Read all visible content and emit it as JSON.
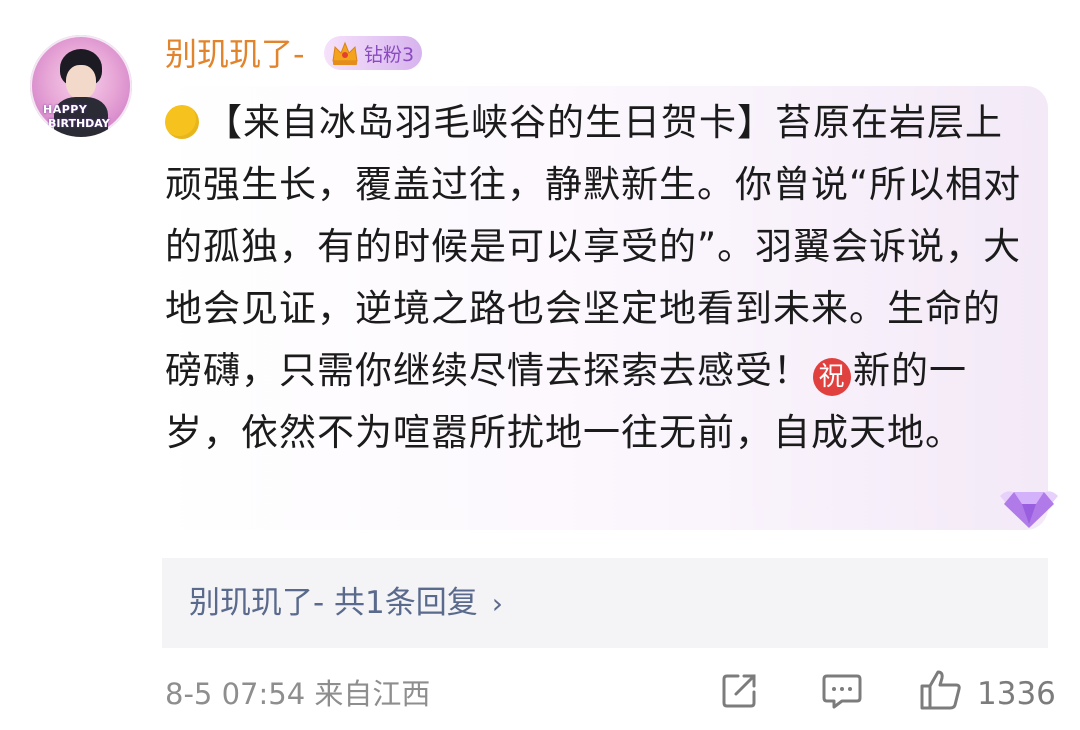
{
  "comment": {
    "username": "别玑玑了-",
    "fan_badge": "钻粉3",
    "avatar_text_1": "HAPPY",
    "avatar_text_2": "BIRTHDAY",
    "body_part1": "【来自冰岛羽毛峡谷的生日贺卡】苔原在岩层上顽强生长，覆盖过往，静默新生。你曾说“所以相对的孤独，有的时候是可以享受的”。羽翼会诉说，大地会见证，逆境之路也会坚定地看到未来。生命的磅礴，只需你继续尽情去探索去感受！",
    "zhu_glyph": "祝",
    "body_part2": "新的一岁，依然不为喧嚣所扰地一往无前，自成天地。",
    "reply_summary": "别玑玑了- 共1条回复",
    "chevron": "›",
    "timestamp": "8-5 07:54",
    "location": "来自江西",
    "like_count": "1336"
  },
  "icons": {
    "crown": "crown-icon",
    "diamond": "diamond-badge-icon",
    "share": "share-icon",
    "comment": "comment-icon",
    "like": "thumbs-up-icon"
  },
  "colors": {
    "username": "#e2842c",
    "reply_link": "#5a6a8c",
    "meta": "#8e8e8e"
  }
}
